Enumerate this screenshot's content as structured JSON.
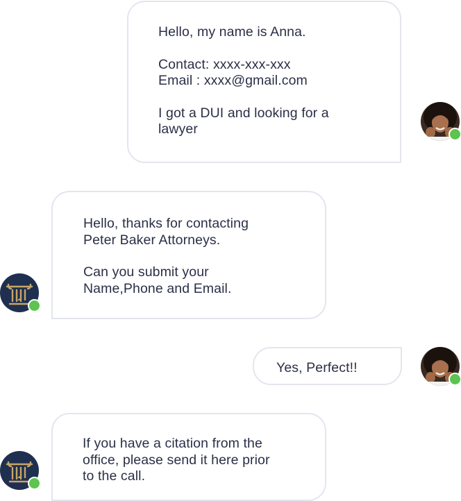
{
  "colors": {
    "online_status": "#5cc44f",
    "bubble_border": "#e3e5ef",
    "text": "#2b2f47",
    "attorney_avatar_bg": "#1f2f4f",
    "attorney_logo_gold": "#c7a567"
  },
  "messages": [
    {
      "sender": "user",
      "avatar_icon": "woman-avatar-icon",
      "paragraphs": [
        [
          "Hello, my name is Anna."
        ],
        [
          "Contact: xxxx-xxx-xxx",
          "Email : xxxx@gmail.com"
        ],
        [
          "I got a DUI and looking for a",
          "lawyer"
        ]
      ]
    },
    {
      "sender": "attorney",
      "avatar_icon": "law-firm-pillar-logo-icon",
      "paragraphs": [
        [
          "Hello, thanks for contacting",
          "Peter Baker Attorneys."
        ],
        [
          "Can you submit your",
          "Name,Phone and Email."
        ]
      ]
    },
    {
      "sender": "user",
      "avatar_icon": "woman-avatar-icon",
      "paragraphs": [
        [
          "Yes, Perfect!!"
        ]
      ]
    },
    {
      "sender": "attorney",
      "avatar_icon": "law-firm-pillar-logo-icon",
      "paragraphs": [
        [
          "If you have a citation from the",
          "office, please send it here prior",
          "to the call."
        ]
      ]
    }
  ]
}
